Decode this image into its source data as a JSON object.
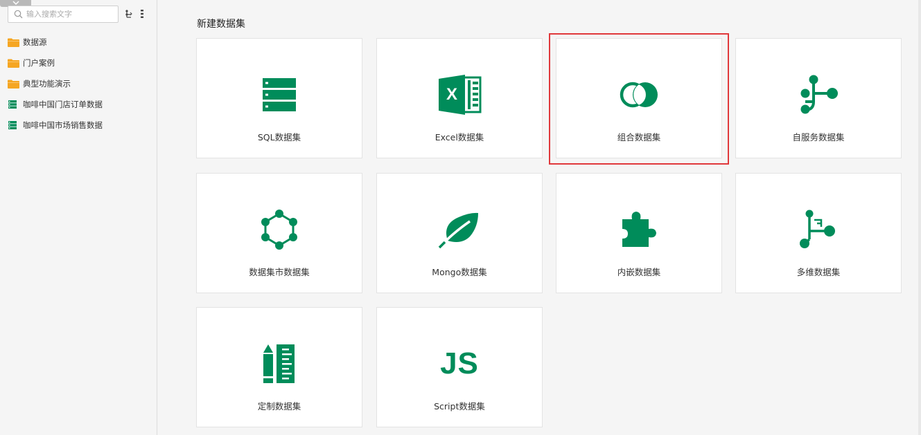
{
  "sidebar": {
    "search": {
      "placeholder": "输入搜索文字",
      "value": ""
    },
    "tree": [
      {
        "label": "数据源",
        "icon": "folder-icon"
      },
      {
        "label": "门户案例",
        "icon": "folder-icon"
      },
      {
        "label": "典型功能演示",
        "icon": "folder-icon"
      },
      {
        "label": "咖啡中国门店订单数据",
        "icon": "dataset-icon"
      },
      {
        "label": "咖啡中国市场销售数据",
        "icon": "dataset-icon"
      }
    ]
  },
  "main": {
    "title": "新建数据集",
    "cards": [
      {
        "label": "SQL数据集",
        "icon": "sql-dataset-icon"
      },
      {
        "label": "Excel数据集",
        "icon": "excel-dataset-icon"
      },
      {
        "label": "组合数据集",
        "icon": "combined-dataset-icon",
        "highlighted": true
      },
      {
        "label": "自服务数据集",
        "icon": "self-service-dataset-icon"
      },
      {
        "label": "数据集市数据集",
        "icon": "data-mart-dataset-icon"
      },
      {
        "label": "Mongo数据集",
        "icon": "mongo-dataset-icon"
      },
      {
        "label": "内嵌数据集",
        "icon": "embedded-dataset-icon"
      },
      {
        "label": "多维数据集",
        "icon": "multidimensional-dataset-icon"
      },
      {
        "label": "定制数据集",
        "icon": "custom-dataset-icon"
      },
      {
        "label": "Script数据集",
        "icon": "script-dataset-icon",
        "glyph": "JS"
      }
    ]
  },
  "colors": {
    "accent_green": "#008c5a",
    "folder_orange": "#f5a623",
    "highlight_red": "#e0383b",
    "background": "#f5f5f5"
  }
}
